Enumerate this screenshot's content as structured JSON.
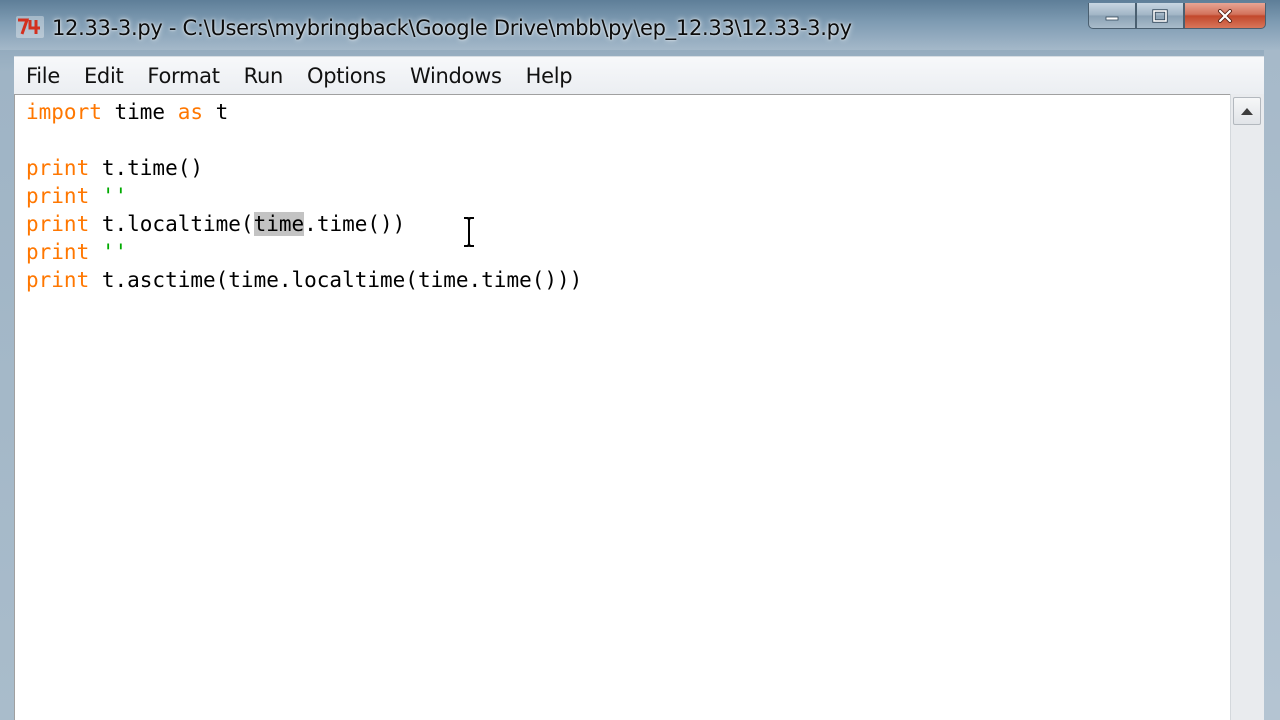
{
  "window": {
    "title": "12.33-3.py - C:\\Users\\mybringback\\Google Drive\\mbb\\py\\ep_12.33\\12.33-3.py",
    "app_icon": "python-idle-icon",
    "controls": [
      "minimize-icon",
      "maximize-icon",
      "close-icon"
    ]
  },
  "menu": {
    "items": [
      {
        "label": "File"
      },
      {
        "label": "Edit"
      },
      {
        "label": "Format"
      },
      {
        "label": "Run"
      },
      {
        "label": "Options"
      },
      {
        "label": "Windows"
      },
      {
        "label": "Help"
      }
    ]
  },
  "editor": {
    "lines": [
      [
        {
          "t": "import",
          "c": "kw"
        },
        {
          "t": " time "
        },
        {
          "t": "as",
          "c": "kw"
        },
        {
          "t": " t"
        }
      ],
      [],
      [
        {
          "t": "print",
          "c": "kw"
        },
        {
          "t": " t.time()"
        }
      ],
      [
        {
          "t": "print",
          "c": "kw"
        },
        {
          "t": " "
        },
        {
          "t": "''",
          "c": "str"
        }
      ],
      [
        {
          "t": "print",
          "c": "kw"
        },
        {
          "t": " t.localtime("
        },
        {
          "t": "time",
          "c": "sel"
        },
        {
          "t": ".time())"
        }
      ],
      [
        {
          "t": "print",
          "c": "kw"
        },
        {
          "t": " "
        },
        {
          "t": "''",
          "c": "str"
        }
      ],
      [
        {
          "t": "print",
          "c": "kw"
        },
        {
          "t": " t.asctime(time.localtime(time.time()))"
        }
      ]
    ],
    "colors": {
      "keyword": "#ff7700",
      "string": "#00aa00",
      "selection": "#c3c3c3",
      "text": "#000000",
      "background": "#ffffff"
    }
  },
  "scrollbar": {
    "up_icon": "scroll-up-arrow-icon"
  }
}
